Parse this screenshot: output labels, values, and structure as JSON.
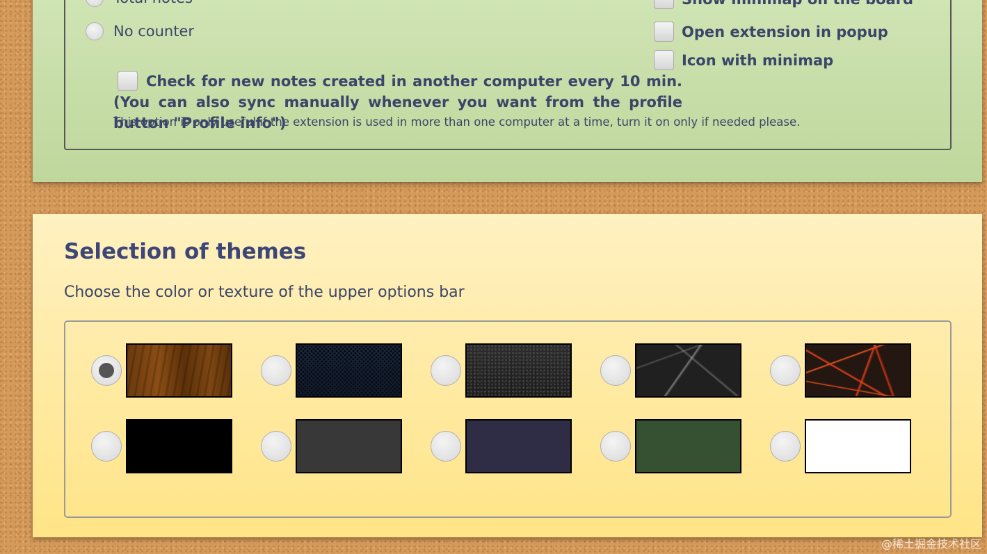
{
  "counter_options": {
    "items": [
      {
        "label": "Total notes"
      },
      {
        "label": "No counter"
      }
    ]
  },
  "display_options": {
    "items": [
      {
        "label": "Show minimap on the board",
        "checked": true
      },
      {
        "label": "Open extension in popup",
        "checked": false
      },
      {
        "label": "Icon with minimap",
        "checked": false
      }
    ]
  },
  "sync_option": {
    "checked": false,
    "label": "Check for new notes created in another computer every 10 min. (You can also sync manually whenever you want from the profile button \"Profile info\")",
    "note": "This option is only useful if the extension is used in more than one computer at a time, turn it on only if needed please."
  },
  "themes": {
    "title": "Selection of themes",
    "subtitle": "Choose the color or texture of the upper options bar",
    "selected_index": 0,
    "options": [
      {
        "name": "wood",
        "kind": "texture"
      },
      {
        "name": "dark-mesh",
        "kind": "texture"
      },
      {
        "name": "granite",
        "kind": "texture"
      },
      {
        "name": "marble",
        "kind": "texture"
      },
      {
        "name": "lava",
        "kind": "texture"
      },
      {
        "name": "black",
        "kind": "color",
        "color": "#000000"
      },
      {
        "name": "dark-gray",
        "kind": "color",
        "color": "#383838"
      },
      {
        "name": "navy",
        "kind": "color",
        "color": "#2f2d45"
      },
      {
        "name": "green",
        "kind": "color",
        "color": "#355131"
      },
      {
        "name": "white",
        "kind": "color",
        "color": "#ffffff"
      }
    ]
  },
  "colors": {
    "text": "#3a4569",
    "title": "#3d4677",
    "green_panel": "#c8e0aa",
    "yellow_panel": "#ffeaa5",
    "cork": "#d59a5a"
  },
  "watermark": "@稀土掘金技术社区"
}
